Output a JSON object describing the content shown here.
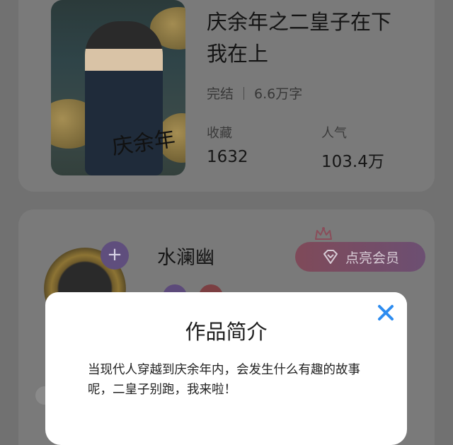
{
  "book": {
    "title": "庆余年之二皇子在下我在上",
    "status": "完结",
    "word_count": "6.6万字",
    "collect_label": "收藏",
    "collect_value": "1632",
    "popularity_label": "人气",
    "popularity_value": "103.4万",
    "cover_title": "庆余年"
  },
  "author": {
    "name": "水澜幽",
    "follow_icon": "plus-icon",
    "vip_button_label": "点亮会员"
  },
  "modal": {
    "title": "作品简介",
    "body": "当现代人穿越到庆余年内，会发生什么有趣的故事呢，二皇子别跑，我来啦！",
    "close_icon": "close-icon"
  },
  "colors": {
    "accent_blue": "#2d8cf0",
    "overlay": "#717171",
    "modal_bg": "#ffffff"
  }
}
